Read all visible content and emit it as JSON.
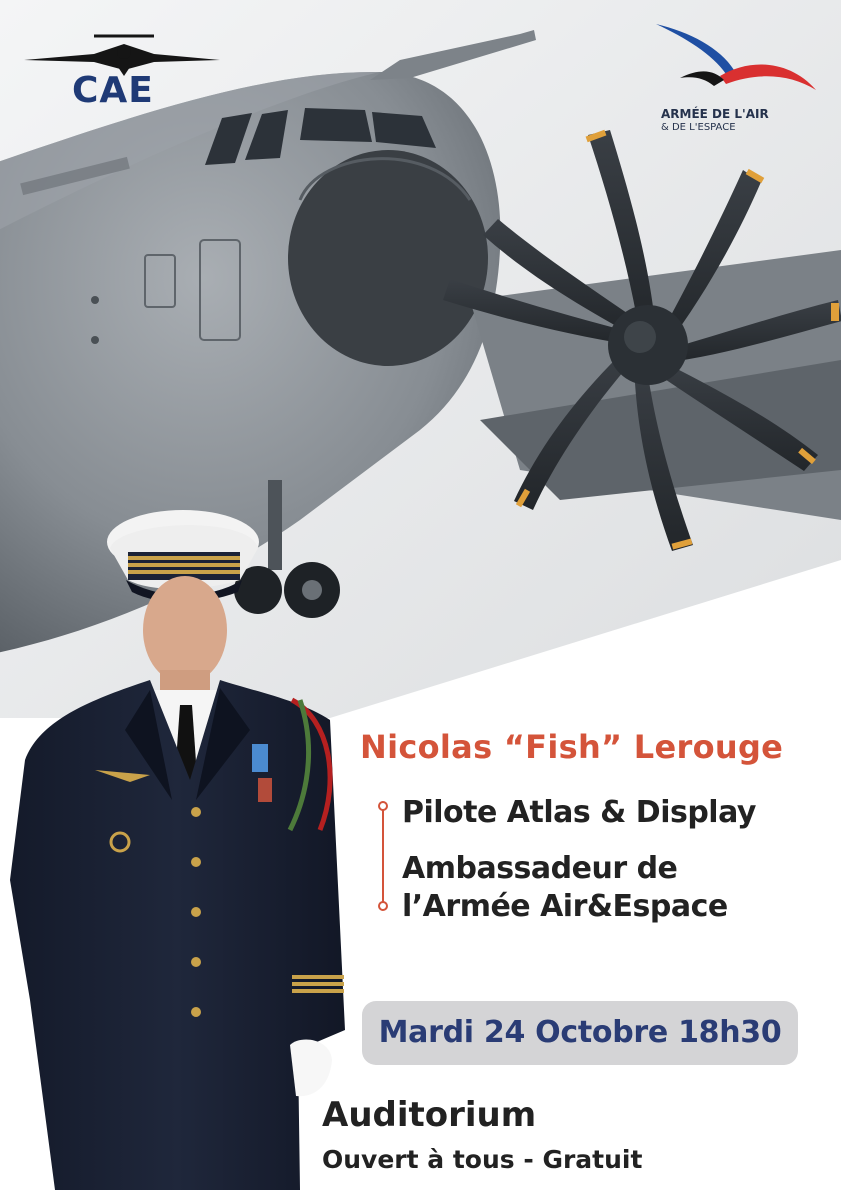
{
  "logos": {
    "cae": {
      "text": "CAE"
    },
    "armee_air": {
      "line1": "ARMÉE DE L'AIR",
      "line2": "& DE L'ESPACE"
    }
  },
  "speaker": {
    "name": "Nicolas “Fish” Lerouge",
    "roles": [
      {
        "lines": [
          "Pilote Atlas & Display"
        ]
      },
      {
        "lines": [
          "Ambassadeur de",
          "l’Armée Air&Espace"
        ]
      }
    ]
  },
  "event": {
    "date": "Mardi 24 Octobre 18h30",
    "venue": "Auditorium",
    "access": "Ouvert à tous - Gratuit"
  },
  "colors": {
    "accent": "#d4543a",
    "navy": "#2a3c75",
    "date_box": "#d4d4d6",
    "text": "#222222"
  }
}
